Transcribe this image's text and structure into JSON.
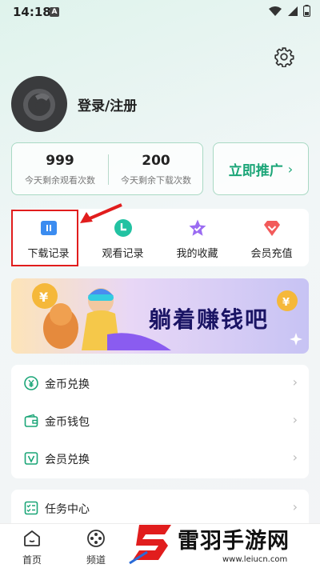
{
  "status_bar": {
    "time": "14:18",
    "a_badge": "A"
  },
  "profile": {
    "login_label": "登录/注册"
  },
  "stats": [
    {
      "value": "999",
      "label": "今天剩余观看次数"
    },
    {
      "value": "200",
      "label": "今天剩余下载次数"
    }
  ],
  "promote": {
    "label": "立即推广",
    "chevron": "›"
  },
  "quick_actions": [
    {
      "label": "下载记录",
      "icon": "download-pause-icon",
      "color": "#3b8cf0"
    },
    {
      "label": "观看记录",
      "icon": "clock-icon",
      "color": "#22c2a2"
    },
    {
      "label": "我的收藏",
      "icon": "star-icon",
      "color": "#9b6cf2"
    },
    {
      "label": "会员充值",
      "icon": "diamond-icon",
      "color": "#f25a5a"
    }
  ],
  "banner": {
    "text": "躺着赚钱吧"
  },
  "menu": [
    {
      "label": "金币兑换",
      "icon": "yen-coin-icon"
    },
    {
      "label": "金币钱包",
      "icon": "wallet-icon"
    },
    {
      "label": "会员兑换",
      "icon": "vip-icon"
    }
  ],
  "task": {
    "label": "任务中心",
    "icon": "task-list-icon"
  },
  "bottom_nav": [
    {
      "label": "首页",
      "icon": "home-icon"
    },
    {
      "label": "频道",
      "icon": "film-reel-icon"
    }
  ],
  "watermark": {
    "title": "雷羽手游网",
    "url": "www.leiucn.com"
  },
  "colors": {
    "accent": "#1aa577",
    "highlight": "#e11d1d"
  }
}
